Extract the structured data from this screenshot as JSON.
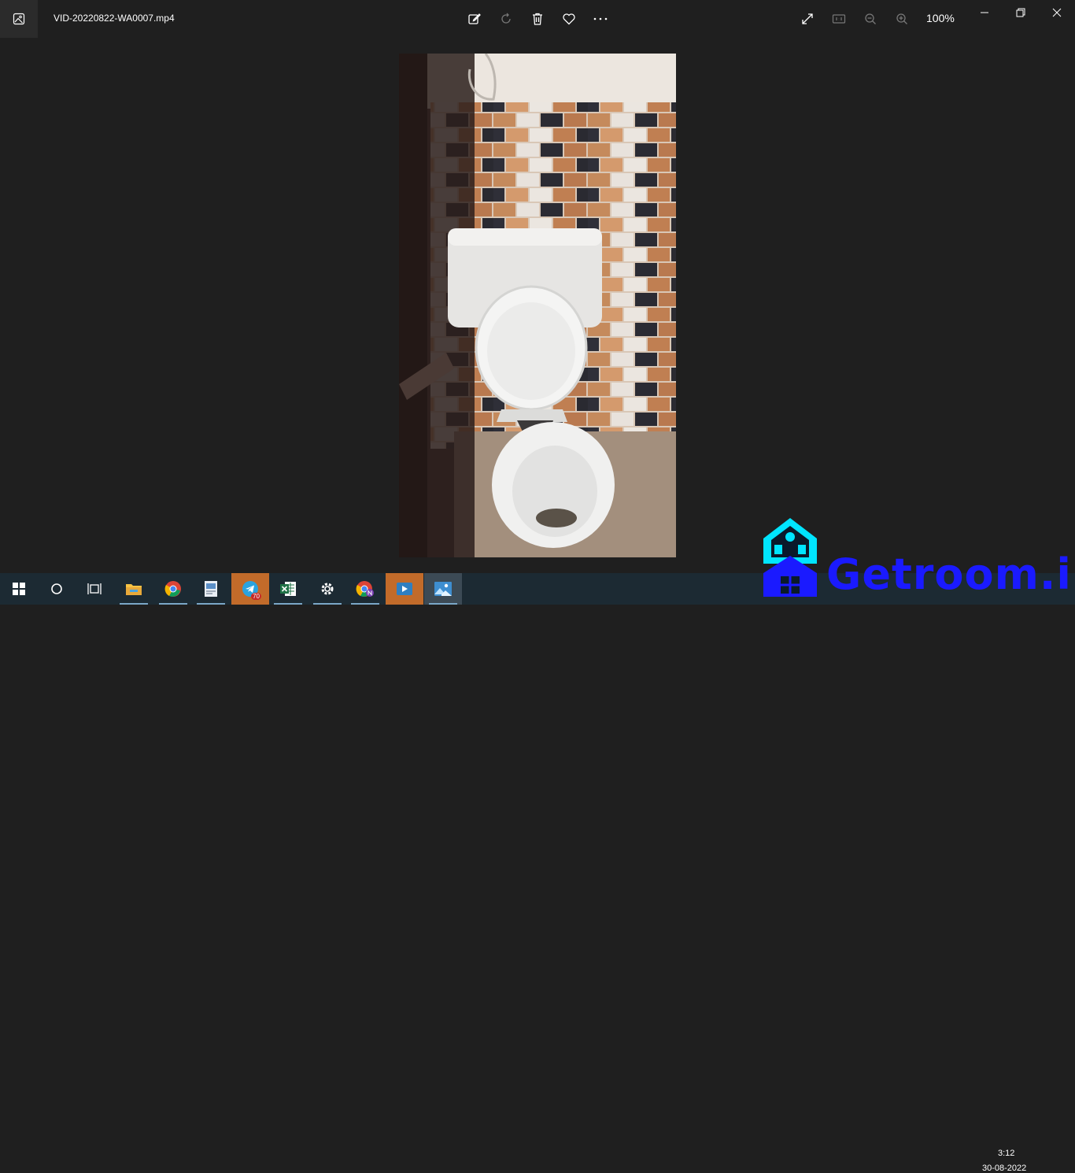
{
  "window": {
    "filename": "VID-20220822-WA0007.mp4",
    "zoom": "100%"
  },
  "toolbar": {
    "icons": [
      "edit-icon",
      "rotate-icon",
      "delete-icon",
      "favorite-icon",
      "more-icon",
      "fullscreen-icon",
      "actual-size-icon",
      "zoom-out-icon",
      "zoom-in-icon"
    ]
  },
  "taskbar": {
    "apps": [
      "start-icon",
      "cortana-icon",
      "task-view-icon",
      "file-explorer-icon",
      "chrome-icon",
      "document-app-icon",
      "telegram-icon",
      "excel-icon",
      "settings-icon",
      "chrome-profile-icon",
      "movies-tv-icon",
      "photos-icon"
    ],
    "telegram_badge": "70",
    "time": "3:12",
    "date": "30-08-2022"
  },
  "watermark": {
    "text": "Getroom.in"
  },
  "colors": {
    "background": "#1f1f1f",
    "taskbar": "#1c2a33",
    "watermark_blue": "#1a1aff",
    "watermark_cyan": "#00e5ff",
    "active_app": "#c26b2a"
  }
}
